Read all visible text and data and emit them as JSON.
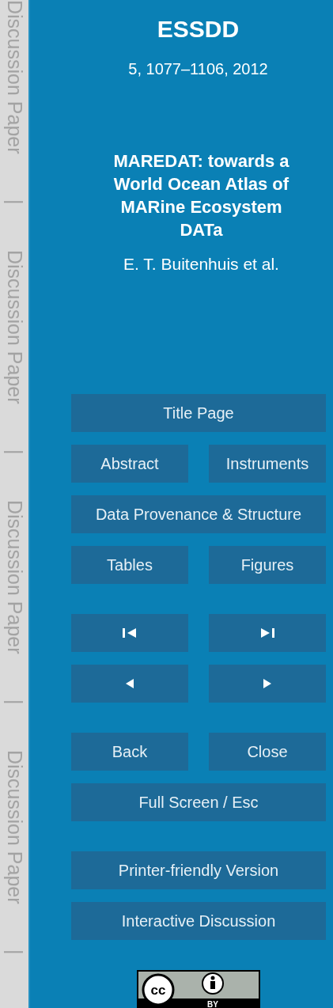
{
  "margin": [
    {
      "label": "Discussion Paper",
      "separator": "|"
    },
    {
      "label": "Discussion Paper",
      "separator": "|"
    },
    {
      "label": "Discussion Paper",
      "separator": "|"
    },
    {
      "label": "Discussion Paper",
      "separator": "|"
    }
  ],
  "journal": "ESSDD",
  "citation": "5, 1077–1106, 2012",
  "title_lines": [
    "MAREDAT: towards a",
    "World Ocean Atlas of",
    "MARine Ecosystem",
    "DATa"
  ],
  "authors": "E. T. Buitenhuis et al.",
  "nav_groups": [
    {
      "rows": [
        [
          {
            "kind": "text",
            "label": "Title Page"
          }
        ],
        [
          {
            "kind": "text",
            "label": "Abstract"
          },
          {
            "kind": "text",
            "label": "Instruments"
          }
        ],
        [
          {
            "kind": "text",
            "label": "Data Provenance & Structure"
          }
        ],
        [
          {
            "kind": "text",
            "label": "Tables"
          },
          {
            "kind": "text",
            "label": "Figures"
          }
        ]
      ]
    },
    {
      "rows": [
        [
          {
            "kind": "first"
          },
          {
            "kind": "last"
          }
        ],
        [
          {
            "kind": "previous"
          },
          {
            "kind": "next"
          }
        ]
      ]
    },
    {
      "rows": [
        [
          {
            "kind": "text",
            "label": "Back"
          },
          {
            "kind": "text",
            "label": "Close"
          }
        ],
        [
          {
            "kind": "text",
            "label": "Full Screen / Esc"
          }
        ]
      ]
    },
    {
      "rows": [
        [
          {
            "kind": "text",
            "label": "Printer-friendly Version"
          }
        ],
        [
          {
            "kind": "text",
            "label": "Interactive Discussion"
          }
        ]
      ]
    }
  ],
  "license": {
    "cc": "cc",
    "by": "BY"
  }
}
